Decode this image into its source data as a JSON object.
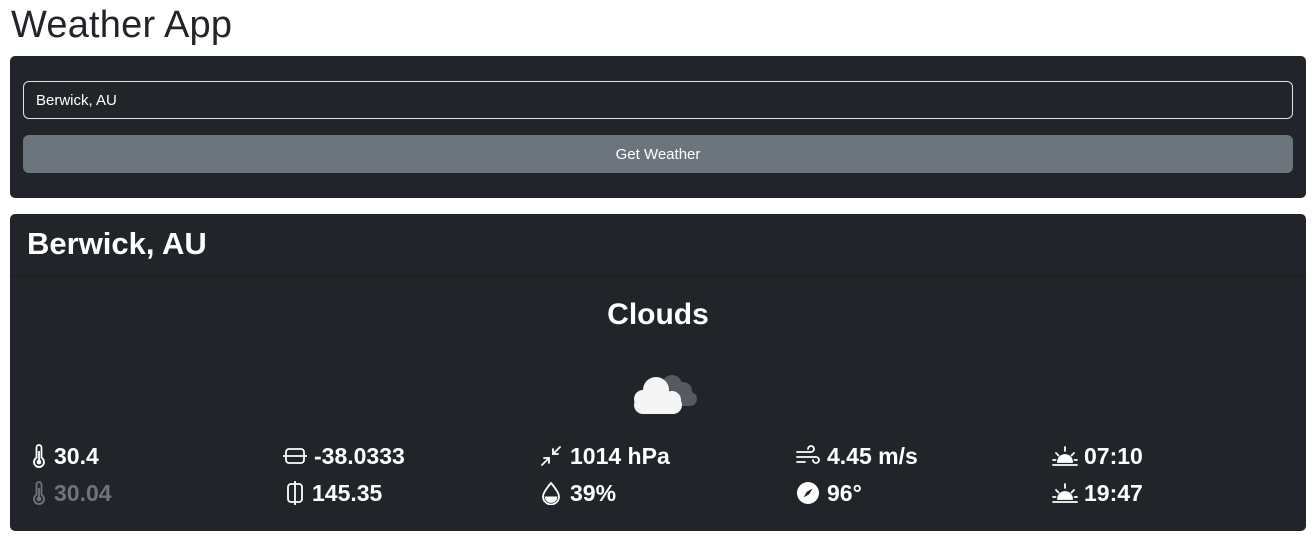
{
  "app": {
    "title": "Weather App"
  },
  "search": {
    "value": "Berwick, AU",
    "button_label": "Get Weather"
  },
  "weather": {
    "location": "Berwick, AU",
    "condition": "Clouds",
    "icon": "clouds-icon",
    "stats": {
      "temp": "30.4",
      "feels_like": "30.04",
      "latitude": "-38.0333",
      "longitude": "145.35",
      "pressure": "1014 hPa",
      "humidity": "39%",
      "wind_speed": "4.45 m/s",
      "wind_direction": "96°",
      "sunrise": "07:10",
      "sunset": "19:47"
    }
  },
  "colors": {
    "card_bg": "#212529",
    "button_bg": "#6c757d",
    "muted_text": "#6c757d",
    "text": "#ffffff"
  }
}
